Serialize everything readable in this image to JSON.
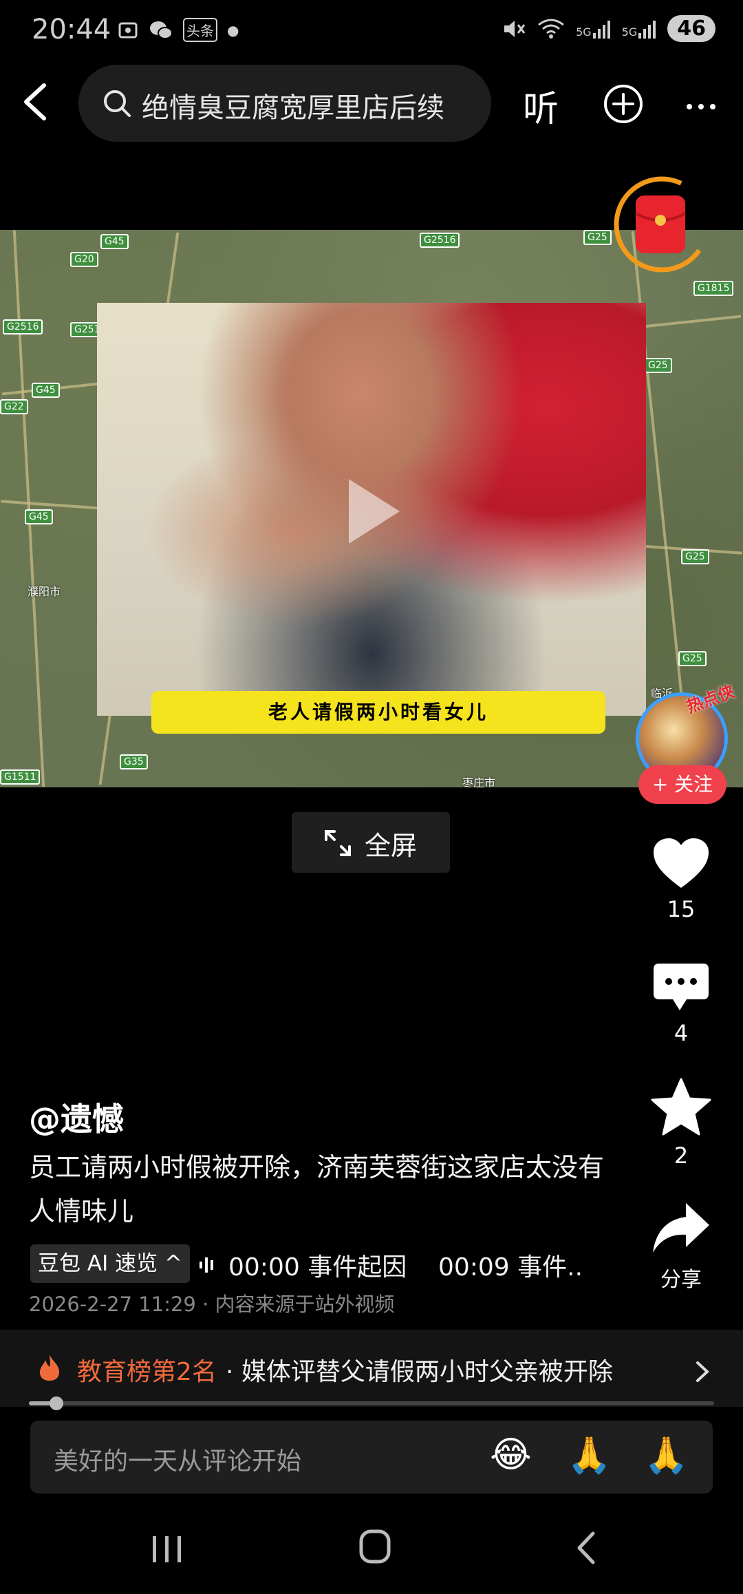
{
  "status_bar": {
    "time": "20:44",
    "left_icons": [
      "screenshot-icon",
      "wechat-icon",
      "toutiao-icon",
      "dot"
    ],
    "toutiao_badge": "头条",
    "net1": "5G",
    "net2": "5G",
    "battery": "46"
  },
  "top_bar": {
    "search_text": "绝情臭豆腐宽厚里店后续",
    "listen_label": "听"
  },
  "video": {
    "caption": "老人请假两小时看女儿",
    "map_labels": [
      "濮阳市",
      "枣庄市",
      "临沂"
    ],
    "road_shields": [
      "G45",
      "G20",
      "G2516",
      "G2516",
      "G45",
      "G22",
      "G45",
      "G25",
      "G1815",
      "G25",
      "G25",
      "G25",
      "G35",
      "G1511",
      "G2516"
    ]
  },
  "author": {
    "hot_tag": "热点侠",
    "follow_label": "+ 关注"
  },
  "fullscreen": {
    "label": "全屏"
  },
  "actions": {
    "like_count": "15",
    "comment_count": "4",
    "favorite_count": "2",
    "share_label": "分享"
  },
  "post": {
    "author": "@遗憾",
    "text": "员工请两小时假被开除，济南芙蓉街这家店太没有人情味儿",
    "ai_chip": "豆包 AI 速览 ^",
    "ai_summary": "00:00 事件起因    00:09 事件..",
    "meta": "2026-2-27 11:29 · 内容来源于站外视频"
  },
  "hot_banner": {
    "rank": "教育榜第2名",
    "title": "· 媒体评替父请假两小时父亲被开除"
  },
  "progress": {
    "fraction": 0.04
  },
  "comment_bar": {
    "placeholder": "美好的一天从评论开始",
    "emojis": [
      "😂",
      "🙏",
      "🙏"
    ]
  }
}
